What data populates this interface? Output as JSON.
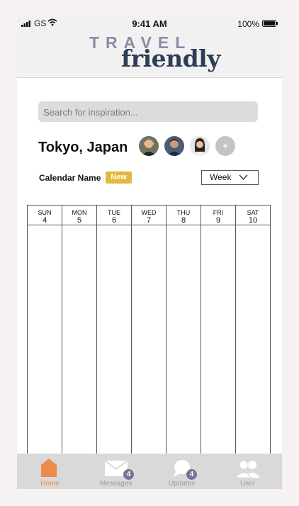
{
  "status_bar": {
    "carrier": "GS",
    "time": "9:41 AM",
    "battery": "100%"
  },
  "logo": {
    "top": "TRAVEL",
    "bottom": "friendly"
  },
  "search": {
    "placeholder": "Search for inspiration..."
  },
  "trip": {
    "location": "Tokyo, Japan",
    "add_label": "+"
  },
  "calendar": {
    "name": "Calendar Name",
    "badge": "New",
    "view": "Week",
    "days": [
      {
        "name": "SUN",
        "num": "4"
      },
      {
        "name": "MON",
        "num": "5"
      },
      {
        "name": "TUE",
        "num": "6"
      },
      {
        "name": "WED",
        "num": "7"
      },
      {
        "name": "THU",
        "num": "8"
      },
      {
        "name": "FRI",
        "num": "9"
      },
      {
        "name": "SAT",
        "num": "10"
      }
    ]
  },
  "tabbar": {
    "tabs": [
      {
        "label": "Home",
        "icon": "home-icon",
        "active": true
      },
      {
        "label": "Messages",
        "icon": "envelope-icon",
        "badge": "4"
      },
      {
        "label": "Updates",
        "icon": "chat-bubble-icon",
        "badge": "4"
      },
      {
        "label": "User",
        "icon": "users-icon"
      }
    ]
  },
  "colors": {
    "accent": "#f08a4b",
    "badge": "#e2b93b",
    "logo_dark": "#2d3e55",
    "logo_light": "#8f8aa6",
    "count_badge": "#7a7296"
  }
}
